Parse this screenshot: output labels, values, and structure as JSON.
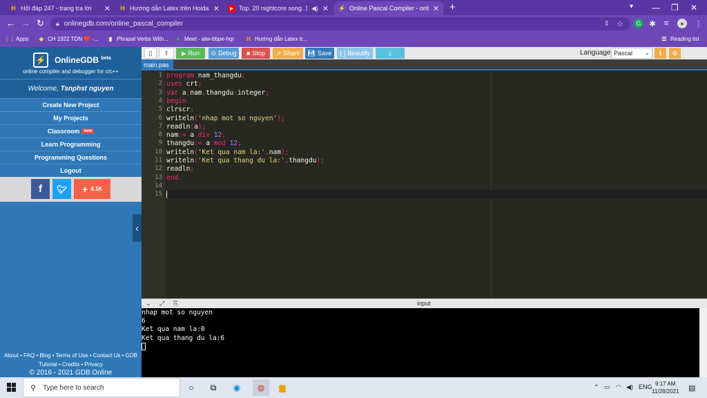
{
  "browser": {
    "tabs": [
      {
        "title": "Hỏi đáp 247 - trang tra lời",
        "icon": "hoidap-icon",
        "active": false
      },
      {
        "title": "Hướng dẫn Latex trên Hoidap247",
        "icon": "hoidap-icon",
        "active": false
      },
      {
        "title": "Top. 20 nightcore song. 1:00",
        "icon": "youtube-icon",
        "active": false
      },
      {
        "title": "Online Pascal Compiler - online c",
        "icon": "onlinegdb-icon",
        "active": true
      }
    ],
    "url": "onlinegdb.com/online_pascal_compiler",
    "bookmarks": [
      {
        "label": "Apps",
        "icon": "apps-grid-icon"
      },
      {
        "label": "CH 1922 TDN ❤️ -...",
        "icon": "bookmark-icon"
      },
      {
        "label": "Phrasal Verbs With...",
        "icon": "book-icon"
      },
      {
        "label": "Meet - atw-bbpe-hqr",
        "icon": "meet-icon"
      },
      {
        "label": "Hướng dẫn Latex tr...",
        "icon": "hoidap-icon"
      }
    ],
    "reading_list": "Reading list"
  },
  "sidebar": {
    "brand": "OnlineGDB",
    "brand_sup": "beta",
    "tagline": "online compiler and debugger for c/c++",
    "welcome_prefix": "Welcome, ",
    "username": "Tsnphst nguyen",
    "menu": [
      {
        "label": "Create New Project"
      },
      {
        "label": "My Projects"
      },
      {
        "label": "Classroom",
        "badge": "new"
      },
      {
        "label": "Learn Programming"
      },
      {
        "label": "Programming Questions"
      },
      {
        "label": "Logout"
      }
    ],
    "share_count": "4.1K",
    "footer_links": "About • FAQ • Blog • Terms of Use • Contact Us • GDB Tutorial • Credits • Privacy",
    "copyright": "© 2016 - 2021 GDB Online"
  },
  "toolbar": {
    "run": "Run",
    "debug": "Debug",
    "stop": "Stop",
    "share": "Share",
    "save": "Save",
    "beautify": "{ } Beautify",
    "language_label": "Language",
    "language_value": "Pascal"
  },
  "editor": {
    "file_tab": "main.pas",
    "lines": [
      "1",
      "2",
      "3",
      "4",
      "5",
      "6",
      "7",
      "8",
      "9",
      "10",
      "11",
      "12",
      "13",
      "14",
      "15"
    ],
    "code": [
      [
        {
          "t": "program ",
          "c": "kw"
        },
        {
          "t": "nam_thangdu",
          "c": "id"
        },
        {
          "t": ";",
          "c": "kw"
        }
      ],
      [
        {
          "t": "uses ",
          "c": "kw"
        },
        {
          "t": "crt",
          "c": "id"
        },
        {
          "t": ";",
          "c": "kw"
        }
      ],
      [
        {
          "t": "var ",
          "c": "kw"
        },
        {
          "t": "a",
          "c": "id"
        },
        {
          "t": ",",
          "c": "kw"
        },
        {
          "t": "nam",
          "c": "id"
        },
        {
          "t": ",",
          "c": "kw"
        },
        {
          "t": "thangdu",
          "c": "id"
        },
        {
          "t": ":",
          "c": "kw"
        },
        {
          "t": "integer",
          "c": "id"
        },
        {
          "t": ";",
          "c": "kw"
        }
      ],
      [
        {
          "t": "begin",
          "c": "kw"
        }
      ],
      [
        {
          "t": "clrscr",
          "c": "id"
        },
        {
          "t": ";",
          "c": "kw"
        }
      ],
      [
        {
          "t": "writeln",
          "c": "id"
        },
        {
          "t": "(",
          "c": "kw"
        },
        {
          "t": "'nhap mot so nguyen'",
          "c": "str"
        },
        {
          "t": ");",
          "c": "kw"
        }
      ],
      [
        {
          "t": "readln",
          "c": "id"
        },
        {
          "t": "(",
          "c": "kw"
        },
        {
          "t": "a",
          "c": "id"
        },
        {
          "t": ");",
          "c": "kw"
        }
      ],
      [
        {
          "t": "nam",
          "c": "id"
        },
        {
          "t": ":= ",
          "c": "kw"
        },
        {
          "t": "a ",
          "c": "id"
        },
        {
          "t": "div ",
          "c": "kw"
        },
        {
          "t": "12",
          "c": "num"
        },
        {
          "t": ";",
          "c": "kw"
        }
      ],
      [
        {
          "t": "thangdu",
          "c": "id"
        },
        {
          "t": ":= ",
          "c": "kw"
        },
        {
          "t": "a ",
          "c": "id"
        },
        {
          "t": "mod ",
          "c": "kw"
        },
        {
          "t": "12",
          "c": "num"
        },
        {
          "t": ";",
          "c": "kw"
        }
      ],
      [
        {
          "t": "writeln",
          "c": "id"
        },
        {
          "t": "(",
          "c": "kw"
        },
        {
          "t": "'Ket qua nam la:'",
          "c": "str"
        },
        {
          "t": ",",
          "c": "kw"
        },
        {
          "t": "nam",
          "c": "id"
        },
        {
          "t": ");",
          "c": "kw"
        }
      ],
      [
        {
          "t": "writeln",
          "c": "id"
        },
        {
          "t": "(",
          "c": "kw"
        },
        {
          "t": "'Ket qua thang du la:'",
          "c": "str"
        },
        {
          "t": ",",
          "c": "kw"
        },
        {
          "t": "thangdu",
          "c": "id"
        },
        {
          "t": ");",
          "c": "kw"
        }
      ],
      [
        {
          "t": "readln",
          "c": "id"
        },
        {
          "t": ";",
          "c": "kw"
        }
      ],
      [
        {
          "t": "end",
          "c": "kw"
        },
        {
          "t": ".",
          "c": "kw"
        }
      ],
      [],
      []
    ]
  },
  "console": {
    "label": "input",
    "lines": [
      "nhap mot so nguyen",
      "6",
      "Ket qua nam la:0",
      "Ket qua thang du la:6"
    ]
  },
  "taskbar": {
    "search_placeholder": "Type here to search",
    "lang": "ENG",
    "time": "9:17 AM",
    "date": "11/28/2021"
  }
}
